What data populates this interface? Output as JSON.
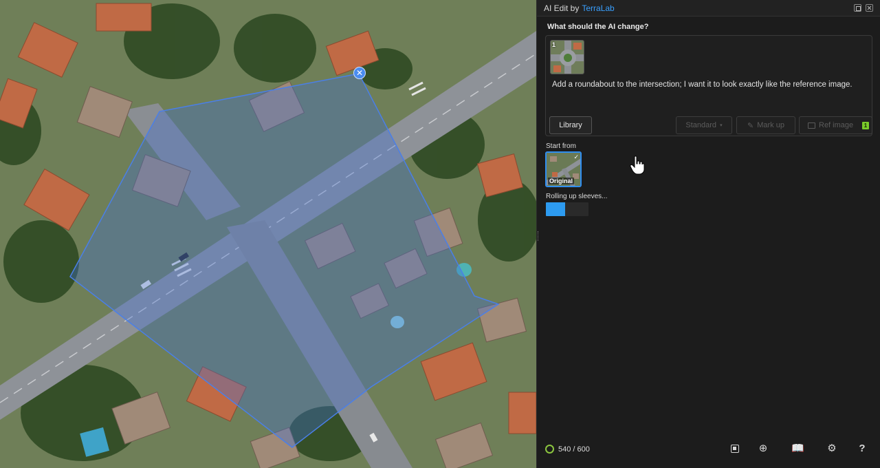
{
  "window": {
    "title_prefix": "AI Edit by",
    "title_brand": "TerraLab"
  },
  "prompt": {
    "question": "What should the AI change?",
    "reference_number": "1",
    "text": "Add a roundabout to the intersection; I want it to look exactly like the reference image."
  },
  "buttons": {
    "library": "Library",
    "standard": "Standard",
    "markup": "Mark up",
    "ref_image": "Ref image",
    "ref_image_count": "1"
  },
  "start_from": {
    "label": "Start from",
    "thumb_label": "Original"
  },
  "status": {
    "text": "Rolling up sleeves...",
    "progress": 0.45
  },
  "footer": {
    "credits": "540 / 600"
  },
  "colors": {
    "accent": "#2d9bf0",
    "brand": "#39a0ff",
    "credit_ring": "#8cc63f",
    "selection": "#3f6fd8"
  }
}
